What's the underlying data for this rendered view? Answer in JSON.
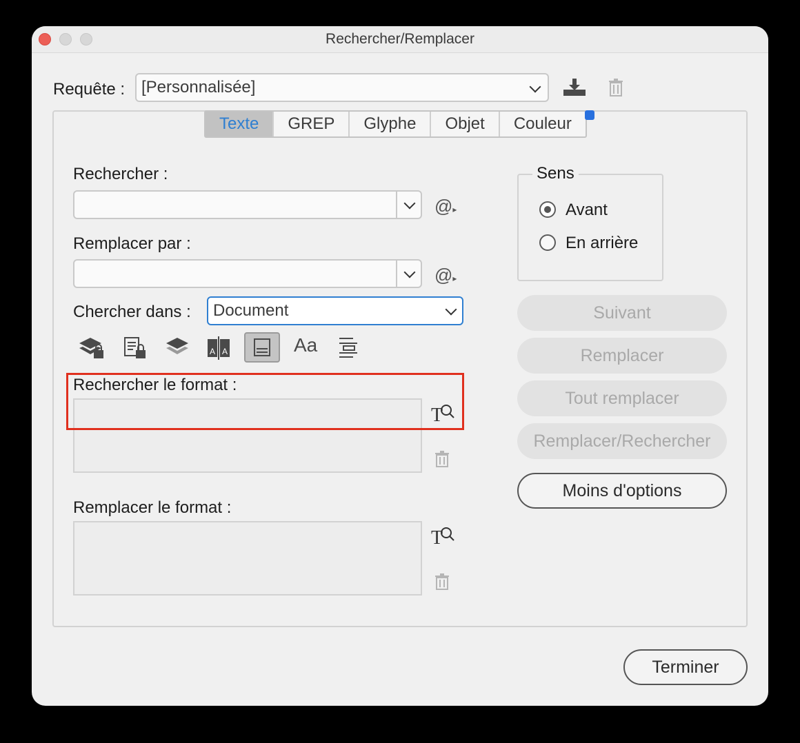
{
  "window": {
    "title": "Rechercher/Remplacer"
  },
  "query": {
    "label": "Requête :",
    "value": "[Personnalisée]"
  },
  "tabs": [
    {
      "label": "Texte",
      "active": true
    },
    {
      "label": "GREP",
      "active": false
    },
    {
      "label": "Glyphe",
      "active": false
    },
    {
      "label": "Objet",
      "active": false
    },
    {
      "label": "Couleur",
      "active": false
    }
  ],
  "find": {
    "label": "Rechercher :",
    "value": ""
  },
  "replace": {
    "label": "Remplacer par :",
    "value": ""
  },
  "search_in": {
    "label": "Chercher dans :",
    "value": "Document"
  },
  "options_icons": [
    "locked-layers-icon",
    "locked-stories-icon",
    "hidden-layers-icon",
    "master-pages-icon",
    "footnotes-icon",
    "case-sensitive-icon",
    "whole-word-icon"
  ],
  "find_format": {
    "label": "Rechercher le format :"
  },
  "replace_format": {
    "label": "Remplacer le format :"
  },
  "direction": {
    "legend": "Sens",
    "options": [
      {
        "label": "Avant",
        "selected": true
      },
      {
        "label": "En arrière",
        "selected": false
      }
    ]
  },
  "buttons": {
    "next": "Suivant",
    "replace": "Remplacer",
    "replace_all": "Tout remplacer",
    "replace_find": "Remplacer/Rechercher",
    "fewer_options": "Moins d'options",
    "done": "Terminer"
  },
  "colors": {
    "accent": "#2f7fd1",
    "highlight": "#e0301e",
    "tab_badge": "#2870de"
  }
}
